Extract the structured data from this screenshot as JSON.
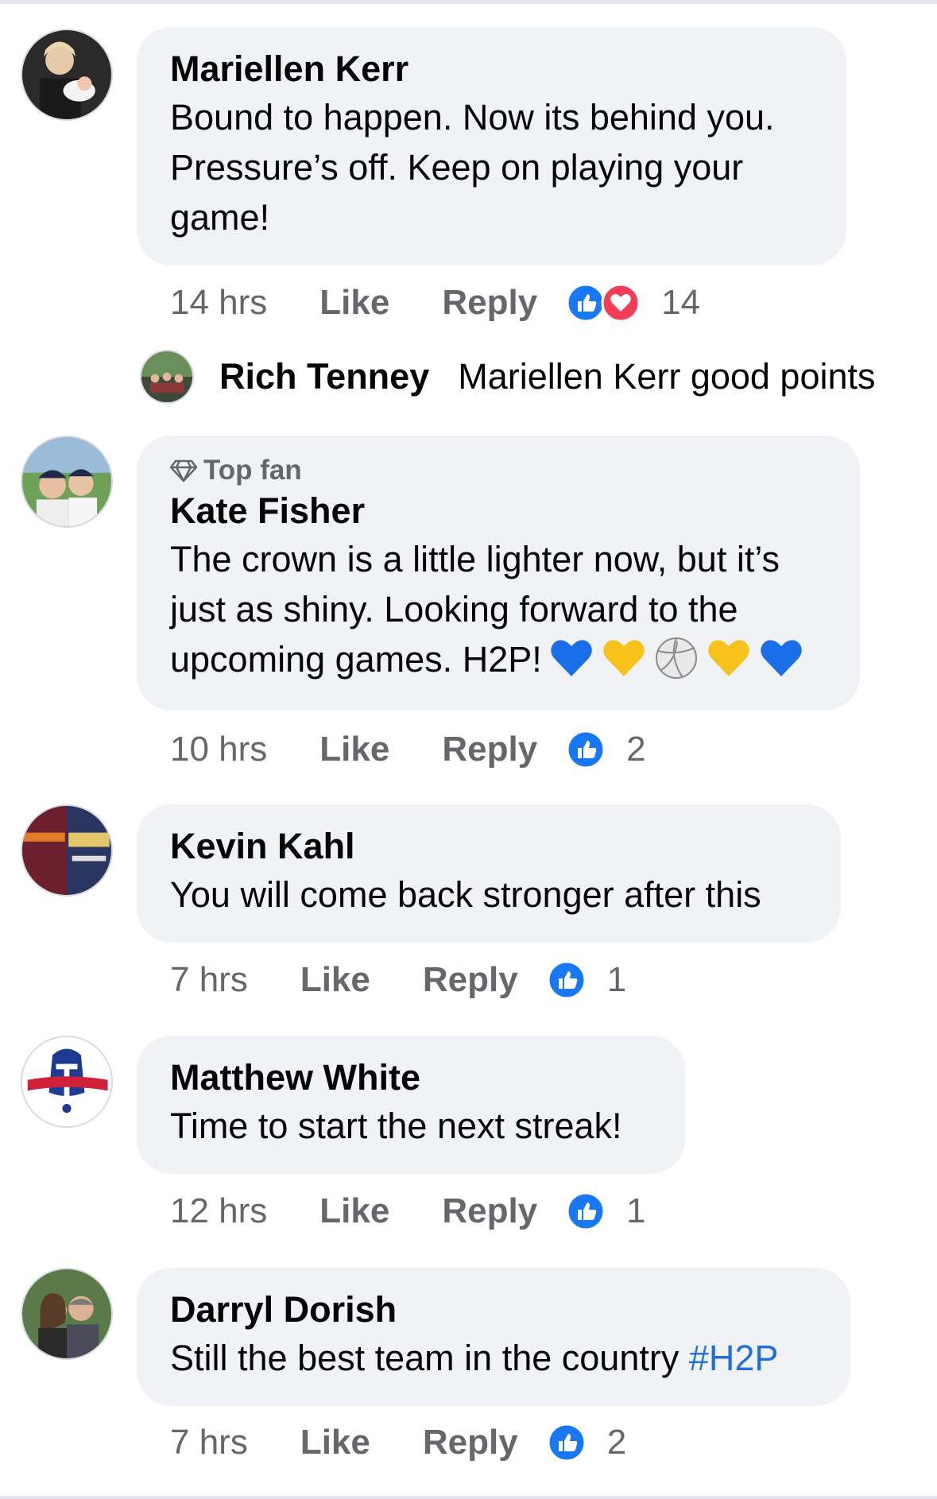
{
  "comments": [
    {
      "author": "Mariellen Kerr",
      "text": "Bound to happen. Now its behind you. Pressure’s off. Keep on playing your game!",
      "time": "14 hrs",
      "like": "Like",
      "reply": "Reply",
      "reactions": [
        "like-icon",
        "love-icon"
      ],
      "count": "14",
      "avatar_icon": "profile-photo"
    },
    {
      "badge": "Top fan",
      "author": "Kate Fisher",
      "text": "The crown is a little lighter now, but it’s just as shiny. Looking forward to the upcoming games. H2P!",
      "emojis": [
        "blue-heart",
        "yellow-heart",
        "volleyball",
        "yellow-heart",
        "blue-heart"
      ],
      "time": "10 hrs",
      "like": "Like",
      "reply": "Reply",
      "count": "2"
    },
    {
      "author": "Kevin Kahl",
      "text": "You will come back stronger after this",
      "time": "7 hrs",
      "like": "Like",
      "reply": "Reply",
      "count": "1"
    },
    {
      "author": "Matthew White",
      "text": "Time to start the next streak!",
      "time": "12 hrs",
      "like": "Like",
      "reply": "Reply",
      "count": "1"
    },
    {
      "author": "Darryl Dorish",
      "text": "Still the best team in the country ",
      "hashtag": "#H2P",
      "time": "7 hrs",
      "like": "Like",
      "reply": "Reply",
      "count": "2"
    }
  ],
  "reply_preview": {
    "author": "Rich Tenney",
    "text": "Mariellen Kerr good points"
  },
  "colors": {
    "bubble": "#f0f2f5",
    "meta_text": "#65676b",
    "like_blue": "#1877f2",
    "love_red": "#f33e58",
    "hashtag": "#216fdb"
  }
}
